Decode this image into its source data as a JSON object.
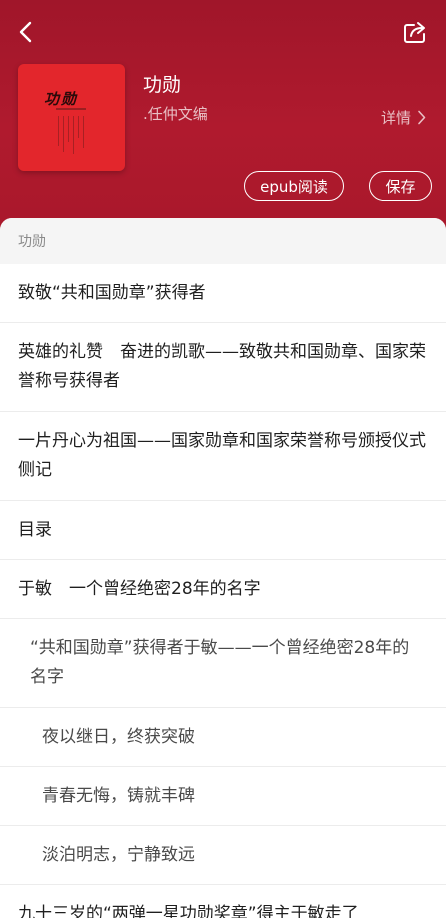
{
  "header": {
    "back_icon": "chevron-left-icon",
    "share_icon": "share-icon",
    "cover_title": "功勋",
    "title": "功勋",
    "author": ".任仲文编",
    "detail_label": "详情",
    "epub_label": "epub阅读",
    "save_label": "保存",
    "background_color": "#a9182b",
    "cover_color": "#e3262c"
  },
  "toc": {
    "heading": "功勋",
    "items": [
      {
        "label": "致敬“共和国勋章”获得者",
        "level": 1
      },
      {
        "label": "英雄的礼赞　奋进的凯歌——致敬共和国勋章、国家荣誉称号获得者",
        "level": 1
      },
      {
        "label": "一片丹心为祖国——国家勋章和国家荣誉称号颁授仪式侧记",
        "level": 1
      },
      {
        "label": "目录",
        "level": 1
      },
      {
        "label": "于敏　一个曾经绝密28年的名字",
        "level": 1
      },
      {
        "label": "“共和国勋章”获得者于敏——一个曾经绝密28年的名字",
        "level": 2
      },
      {
        "label": "夜以继日，终获突破",
        "level": 3
      },
      {
        "label": "青春无悔，铸就丰碑",
        "level": 3
      },
      {
        "label": "淡泊明志，宁静致远",
        "level": 3
      },
      {
        "label": "九十三岁的“两弹一星功勋奖章”得主于敏走了",
        "level": 1
      }
    ]
  }
}
